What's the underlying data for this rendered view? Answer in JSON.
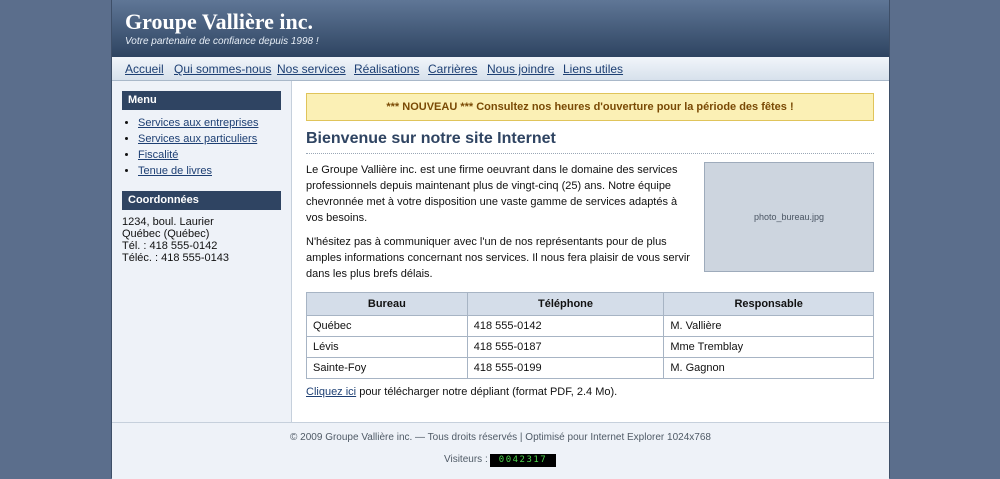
{
  "site": {
    "title": "Groupe Vallière inc.",
    "tagline": "Votre partenaire de confiance depuis 1998 !"
  },
  "nav": {
    "items": [
      {
        "label": "Accueil"
      },
      {
        "label": "Qui sommes-nous"
      },
      {
        "label": "Nos services"
      },
      {
        "label": "Réalisations"
      },
      {
        "label": "Carrières"
      },
      {
        "label": "Nous joindre"
      },
      {
        "label": "Liens utiles"
      }
    ]
  },
  "sidebar": {
    "menu_title": "Menu",
    "menu_items": [
      {
        "label": "Services aux entreprises"
      },
      {
        "label": "Services aux particuliers"
      },
      {
        "label": "Fiscalité"
      },
      {
        "label": "Tenue de livres"
      }
    ],
    "contact_title": "Coordonnées",
    "address_lines": [
      "1234, boul. Laurier",
      "Québec (Québec)",
      "Tél. : 418 555-0142",
      "Téléc. : 418 555-0143"
    ]
  },
  "main": {
    "announcement": "*** NOUVEAU *** Consultez nos heures d'ouverture pour la période des fêtes !",
    "heading": "Bienvenue sur notre site Internet",
    "paragraph1": "Le Groupe Vallière inc. est une firme oeuvrant dans le domaine des services professionnels depuis maintenant plus de vingt-cinq (25) ans. Notre équipe chevronnée met à votre disposition une vaste gamme de services adaptés à vos besoins.",
    "paragraph2": "N'hésitez pas à communiquer avec l'un de nos représentants pour de plus amples informations concernant nos services. Il nous fera plaisir de vous servir dans les plus brefs délais.",
    "photo_label": "photo_bureau.jpg",
    "table": {
      "headers": [
        "Bureau",
        "Téléphone",
        "Responsable"
      ],
      "rows": [
        [
          "Québec",
          "418 555-0142",
          "M. Vallière"
        ],
        [
          "Lévis",
          "418 555-0187",
          "Mme Tremblay"
        ],
        [
          "Sainte-Foy",
          "418 555-0199",
          "M. Gagnon"
        ]
      ]
    },
    "download_link": "Cliquez ici",
    "download_text": " pour télécharger notre dépliant (format PDF, 2.4 Mo)."
  },
  "footer": {
    "copyright": "© 2009 Groupe Vallière inc. — Tous droits réservés | Optimisé pour Internet Explorer 1024x768",
    "visitors_label": "Visiteurs :",
    "visitor_count": "0042317"
  }
}
